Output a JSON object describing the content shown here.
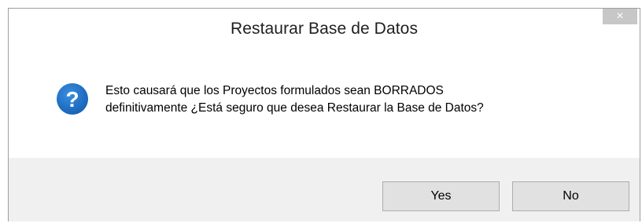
{
  "dialog": {
    "title": "Restaurar Base de Datos",
    "close_glyph": "×",
    "icon": "question-icon",
    "message_line1": "Esto causará que los Proyectos formulados sean BORRADOS",
    "message_line2": "definitivamente ¿Está seguro que desea Restaurar la Base de Datos?",
    "buttons": {
      "yes_label": "Yes",
      "no_label": "No"
    }
  },
  "colors": {
    "icon_blue": "#1a6fc9",
    "footer_bg": "#f0f0f0",
    "button_bg": "#e1e1e1"
  }
}
